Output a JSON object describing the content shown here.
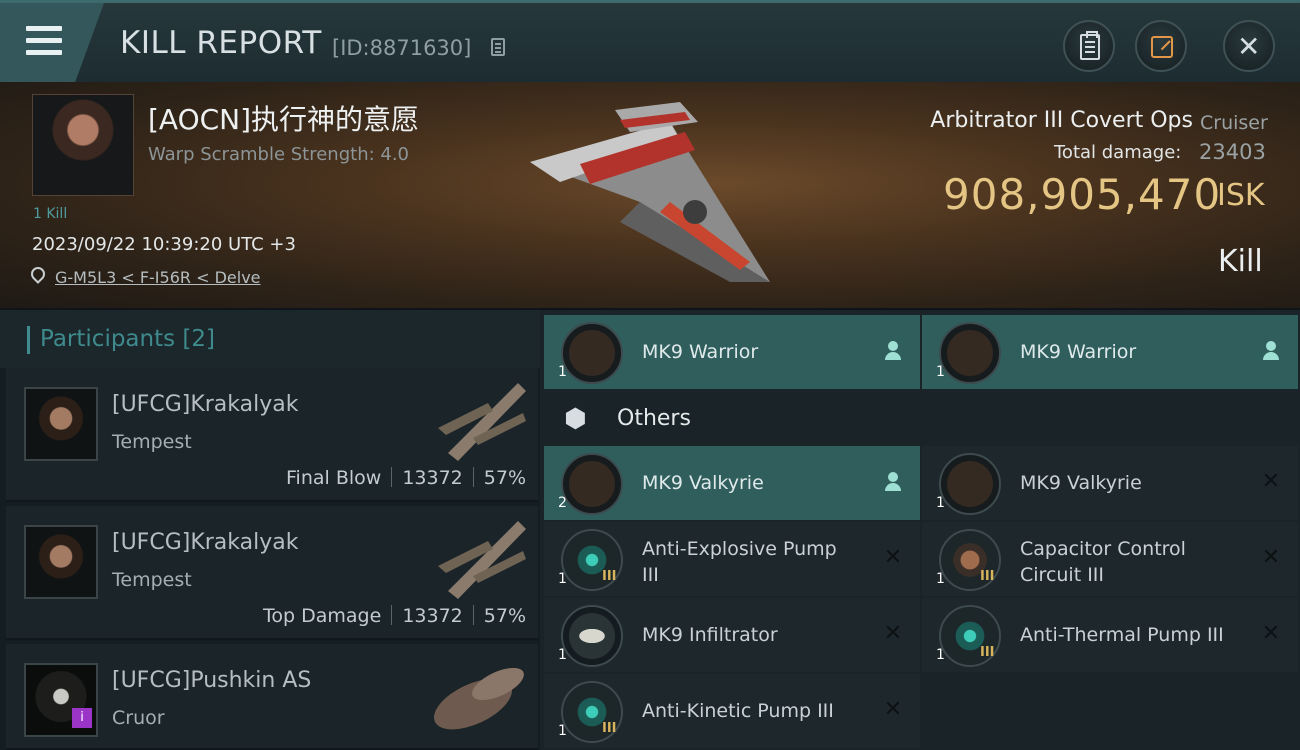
{
  "header": {
    "title": "KILL REPORT",
    "report_id": "[ID:8871630]"
  },
  "victim": {
    "name": "[AOCN]执行神的意愿",
    "subtitle": "Warp Scramble Strength: 4.0",
    "kills": "1 Kill",
    "time": "2023/09/22 10:39:20 UTC +3",
    "location": "G-M5L3 < F-I56R < Delve"
  },
  "ship": {
    "name": "Arbitrator III Covert Ops",
    "class": "Cruiser",
    "damage_label": "Total damage:",
    "damage_value": "23403",
    "isk_value": "908,905,470",
    "isk_unit": "ISK",
    "result": "Kill"
  },
  "participants": {
    "label": "Participants [2]",
    "rows": [
      {
        "name": "[UFCG]Krakalyak",
        "ship": "Tempest",
        "tag": "Final Blow",
        "damage": "13372",
        "percent": "57%"
      },
      {
        "name": "[UFCG]Krakalyak",
        "ship": "Tempest",
        "tag": "Top Damage",
        "damage": "13372",
        "percent": "57%"
      },
      {
        "name": "[UFCG]Pushkin AS",
        "ship": "Cruor",
        "badge": "i"
      }
    ]
  },
  "items": {
    "top": [
      {
        "name": "MK9  Warrior",
        "qty": "1"
      },
      {
        "name": "MK9  Warrior",
        "qty": "1"
      }
    ],
    "others_label": "Others",
    "others": [
      {
        "name": "MK9  Valkyrie",
        "qty": "2"
      },
      {
        "name": "MK9  Valkyrie",
        "qty": "1"
      },
      {
        "name": "Anti-Explosive Pump III",
        "qty": "1",
        "tier": "III"
      },
      {
        "name": "Capacitor Control Circuit III",
        "qty": "1",
        "tier": "III"
      },
      {
        "name": "MK9  Infiltrator",
        "qty": "1"
      },
      {
        "name": "Anti-Thermal Pump III",
        "qty": "1",
        "tier": "III"
      },
      {
        "name": "Anti-Kinetic Pump III",
        "qty": "1",
        "tier": "III"
      }
    ]
  },
  "colors": {
    "accent": "#3e8a8c",
    "highlight": "#2f5e5d",
    "isk": "#e4c584"
  }
}
